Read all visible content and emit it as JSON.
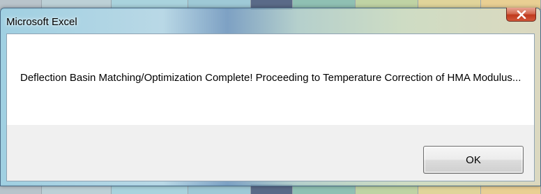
{
  "window": {
    "title": "Microsoft Excel",
    "close_icon": "close-icon"
  },
  "dialog": {
    "message": "Deflection Basin Matching/Optimization Complete! Proceeding to Temperature Correction of HMA Modulus...",
    "ok_label": "OK"
  },
  "colors": {
    "close_button": "#c0391c",
    "dialog_body": "#ffffff",
    "button_area": "#f0f0f0"
  }
}
